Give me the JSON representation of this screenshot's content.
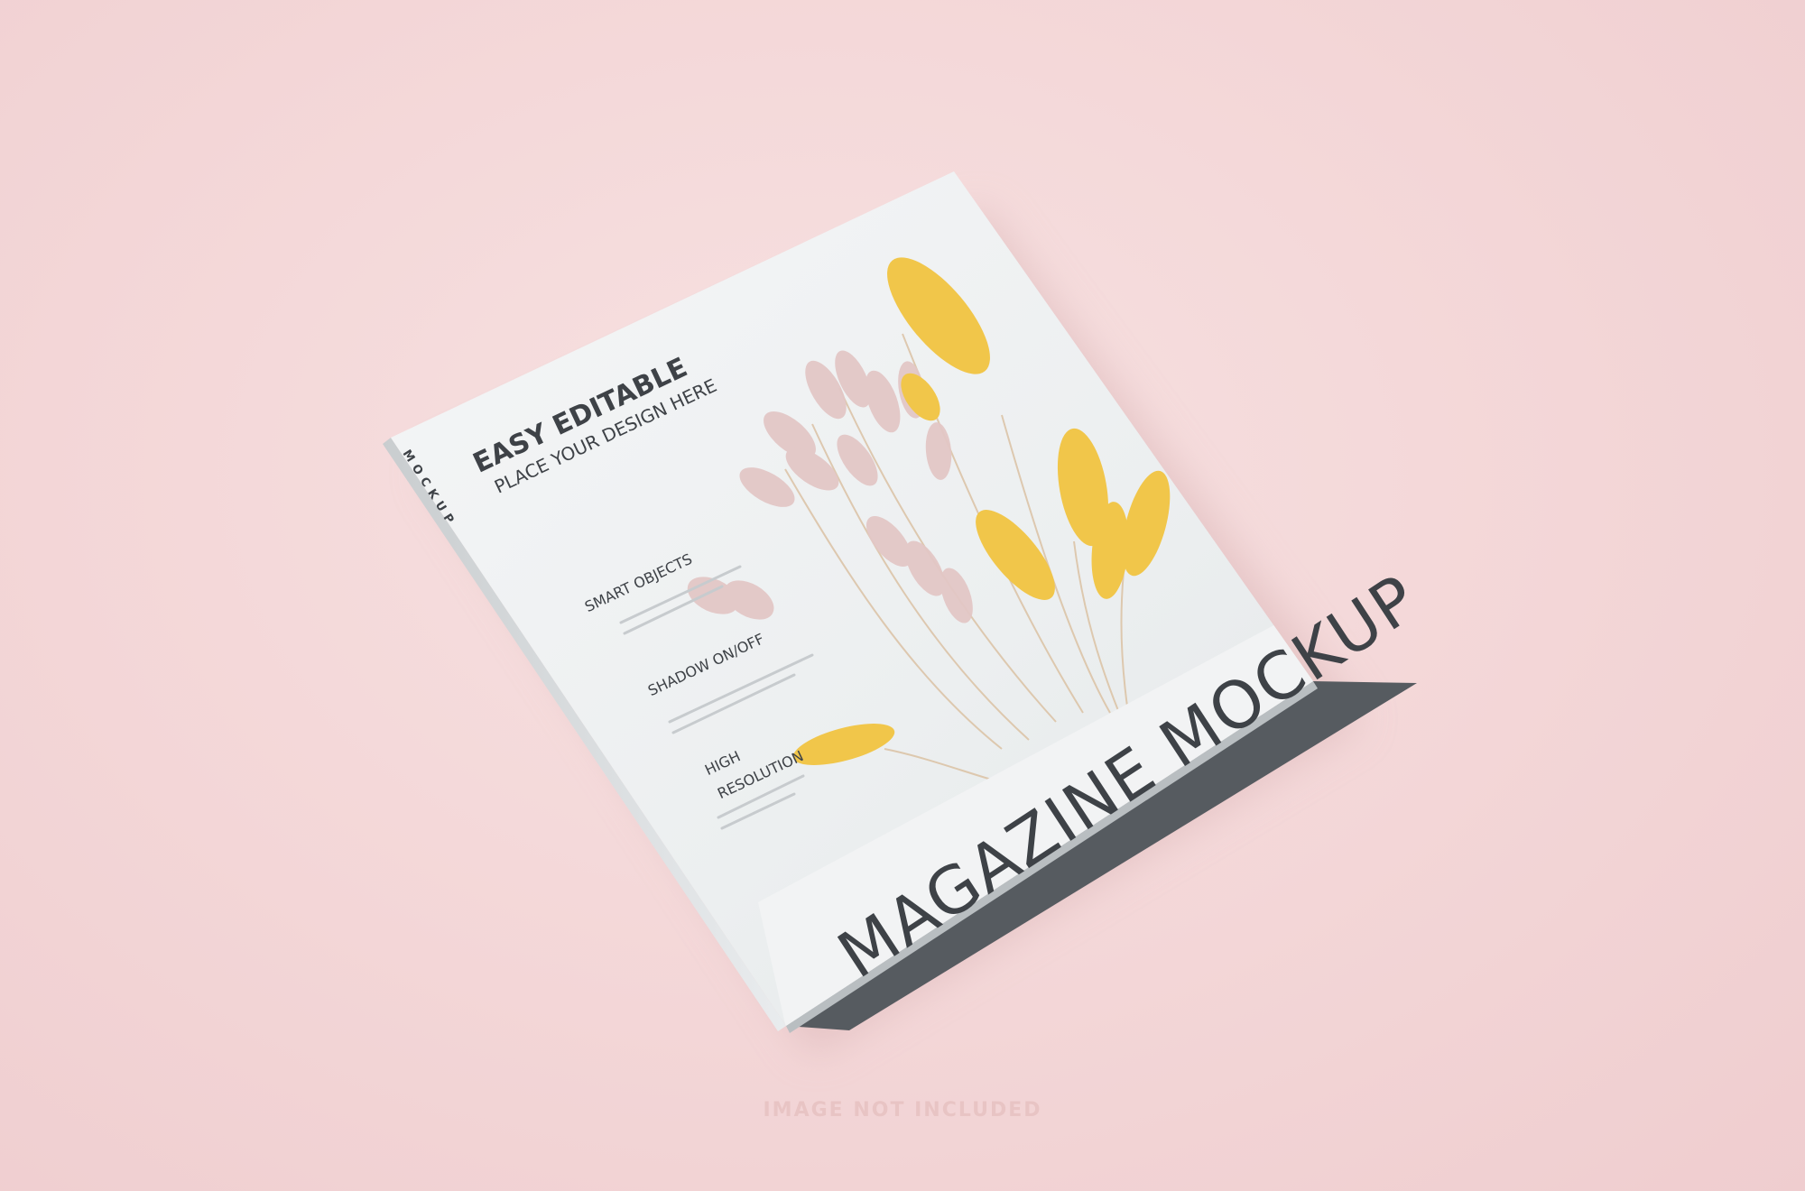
{
  "cover": {
    "headline": "EASY EDITABLE",
    "subheadline": "PLACE YOUR DESIGN HERE",
    "features": [
      {
        "title": "SMART OBJECTS"
      },
      {
        "title": "SHADOW ON/OFF"
      },
      {
        "title_line1": "HIGH",
        "title_line2": "RESOLUTION"
      }
    ],
    "banner_title": "MAGAZINE MOCKUP"
  },
  "spine": {
    "label": "MOCKUP"
  },
  "footer": {
    "note": "IMAGE NOT INCLUDED"
  },
  "colors": {
    "background": "#f3d7d8",
    "cover": "#eef1f2",
    "banner": "#f1f2f3",
    "text": "#3e4247",
    "pink_grass": "#e2c4c4",
    "yellow_grass": "#f0c64b"
  }
}
